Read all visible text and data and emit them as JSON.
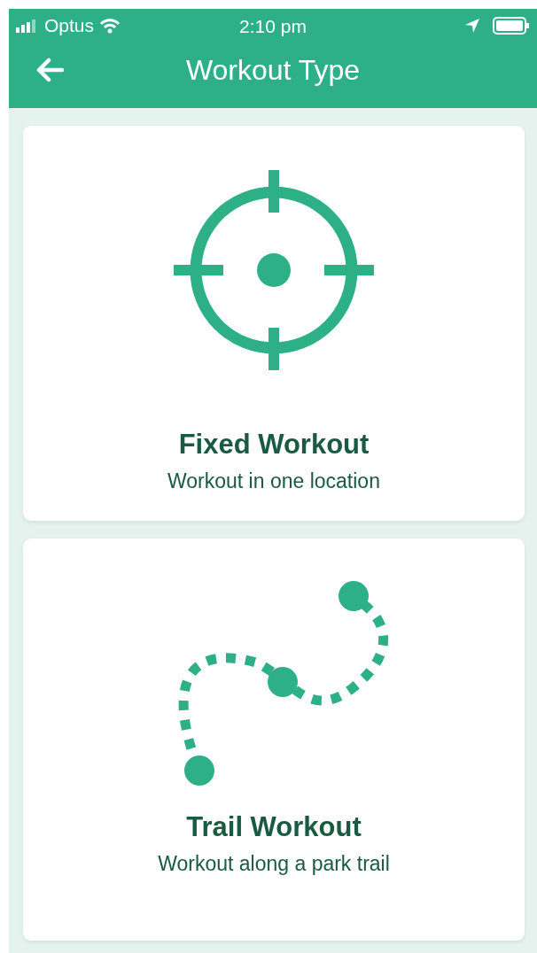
{
  "status_bar": {
    "carrier": "Optus",
    "time": "2:10 pm"
  },
  "header": {
    "title": "Workout Type"
  },
  "options": [
    {
      "kind": "fixed",
      "title": "Fixed Workout",
      "subtitle": "Workout in one location"
    },
    {
      "kind": "trail",
      "title": "Trail Workout",
      "subtitle": "Workout along a park trail"
    }
  ]
}
